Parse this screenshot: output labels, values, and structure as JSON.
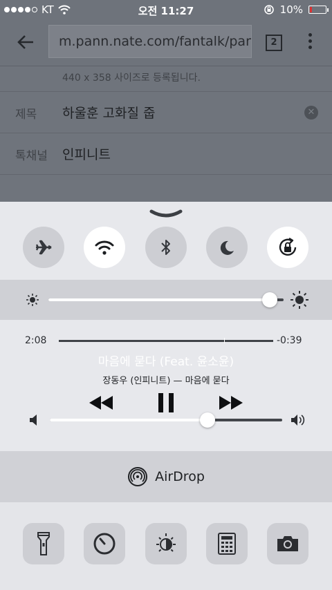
{
  "status_bar": {
    "carrier": "KT",
    "time": "오전 11:27",
    "battery_percent": "10%",
    "battery_level": 0.1
  },
  "browser": {
    "url": "m.pann.nate.com/fantalk/pann",
    "tab_count": "2"
  },
  "form": {
    "hint": "440 x 358 사이즈로 등록됩니다.",
    "title_label": "제목",
    "title_value": "하울훈 고화질 줍",
    "channel_label": "톡채널",
    "channel_value": "인피니트"
  },
  "control_center": {
    "toggles": [
      {
        "name": "airplane-mode",
        "icon": "airplane-icon",
        "on": false
      },
      {
        "name": "wifi",
        "icon": "wifi-icon",
        "on": true
      },
      {
        "name": "bluetooth",
        "icon": "bluetooth-icon",
        "on": false
      },
      {
        "name": "do-not-disturb",
        "icon": "moon-icon",
        "on": false
      },
      {
        "name": "rotation-lock",
        "icon": "rotation-lock-icon",
        "on": true
      }
    ],
    "brightness_level": 0.94,
    "music": {
      "elapsed": "2:08",
      "remaining": "-0:39",
      "progress": 0.77,
      "song_title": "마음에 묻다 (Feat. 윤소윤)",
      "artist_album": "장동우 (인피니트) — 마음에 묻다",
      "volume_level": 0.68
    },
    "airdrop_label": "AirDrop",
    "shortcuts": [
      {
        "name": "flashlight",
        "icon": "flashlight-icon"
      },
      {
        "name": "timer",
        "icon": "timer-icon"
      },
      {
        "name": "night-shift",
        "icon": "night-shift-icon"
      },
      {
        "name": "calculator",
        "icon": "calculator-icon"
      },
      {
        "name": "camera",
        "icon": "camera-icon"
      }
    ],
    "colors": {
      "panel": "#e7e8ec",
      "toggle_off": "#cdced3",
      "toggle_on": "#ffffff",
      "track": "#43464b"
    }
  }
}
